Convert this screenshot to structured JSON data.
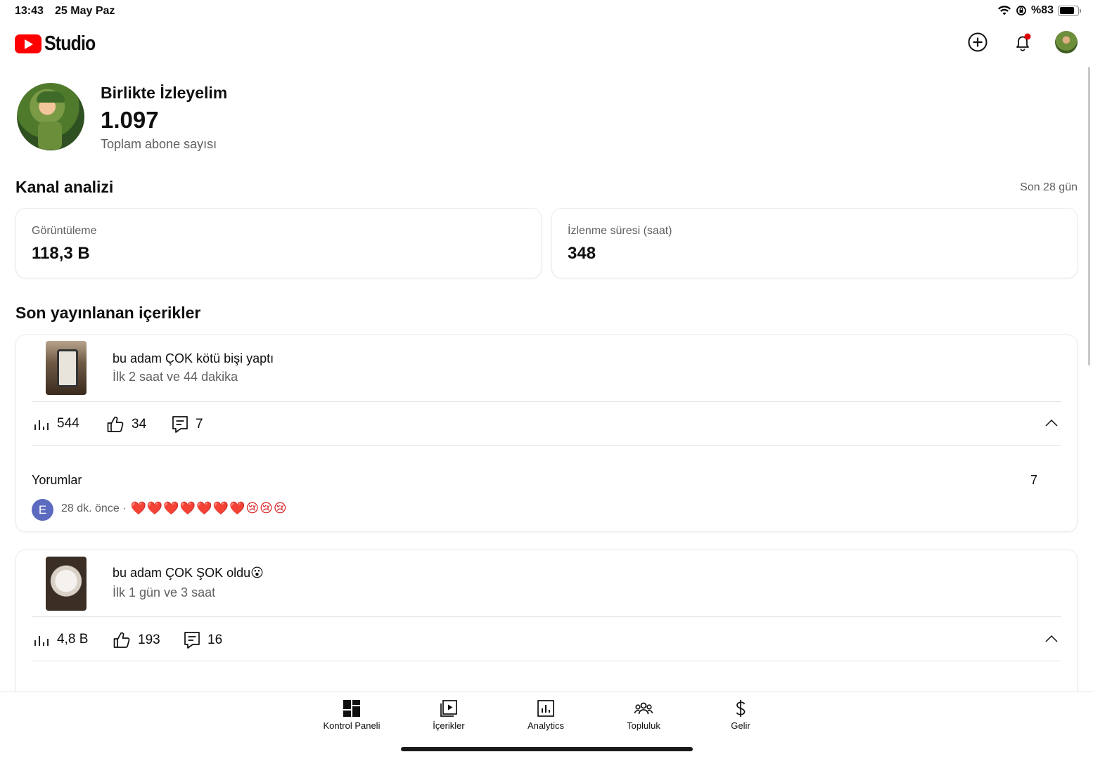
{
  "status_bar": {
    "time": "13:43",
    "date": "25 May Paz",
    "battery_text": "%83"
  },
  "header": {
    "logo_text": "Studio"
  },
  "channel": {
    "name": "Birlikte İzleyelim",
    "subscribers": "1.097",
    "subscribers_label": "Toplam abone sayısı"
  },
  "analytics": {
    "title": "Kanal analizi",
    "period": "Son 28 gün",
    "metrics": [
      {
        "label": "Görüntüleme",
        "value": "118,3 B"
      },
      {
        "label": "İzlenme süresi (saat)",
        "value": "348"
      }
    ]
  },
  "recent": {
    "title": "Son yayınlanan içerikler",
    "videos": [
      {
        "title": "bu adam ÇOK kötü bişi yaptı",
        "subtitle": "İlk 2 saat ve 44 dakika",
        "views": "544",
        "likes": "34",
        "comments": "7",
        "comments_label": "Yorumlar",
        "comments_count": "7",
        "latest_comment": {
          "avatar_letter": "E",
          "time": "28 dk. önce ·",
          "text": "❤️❤️❤️❤️❤️❤️❤️😢😢😢"
        }
      },
      {
        "title": "bu adam ÇOK ŞOK oldu😮",
        "subtitle": "İlk 1 gün ve 3 saat",
        "views": "4,8 B",
        "likes": "193",
        "comments": "16"
      }
    ]
  },
  "bottom_nav": [
    {
      "label": "Kontrol Paneli",
      "icon": "dashboard-icon"
    },
    {
      "label": "İçerikler",
      "icon": "content-icon"
    },
    {
      "label": "Analytics",
      "icon": "analytics-icon"
    },
    {
      "label": "Topluluk",
      "icon": "community-icon"
    },
    {
      "label": "Gelir",
      "icon": "dollar-icon"
    }
  ],
  "colors": {
    "brand": "#ff0000",
    "text": "#0f0f0f",
    "secondary": "#606060",
    "avatar_e": "#5c6bc0"
  }
}
